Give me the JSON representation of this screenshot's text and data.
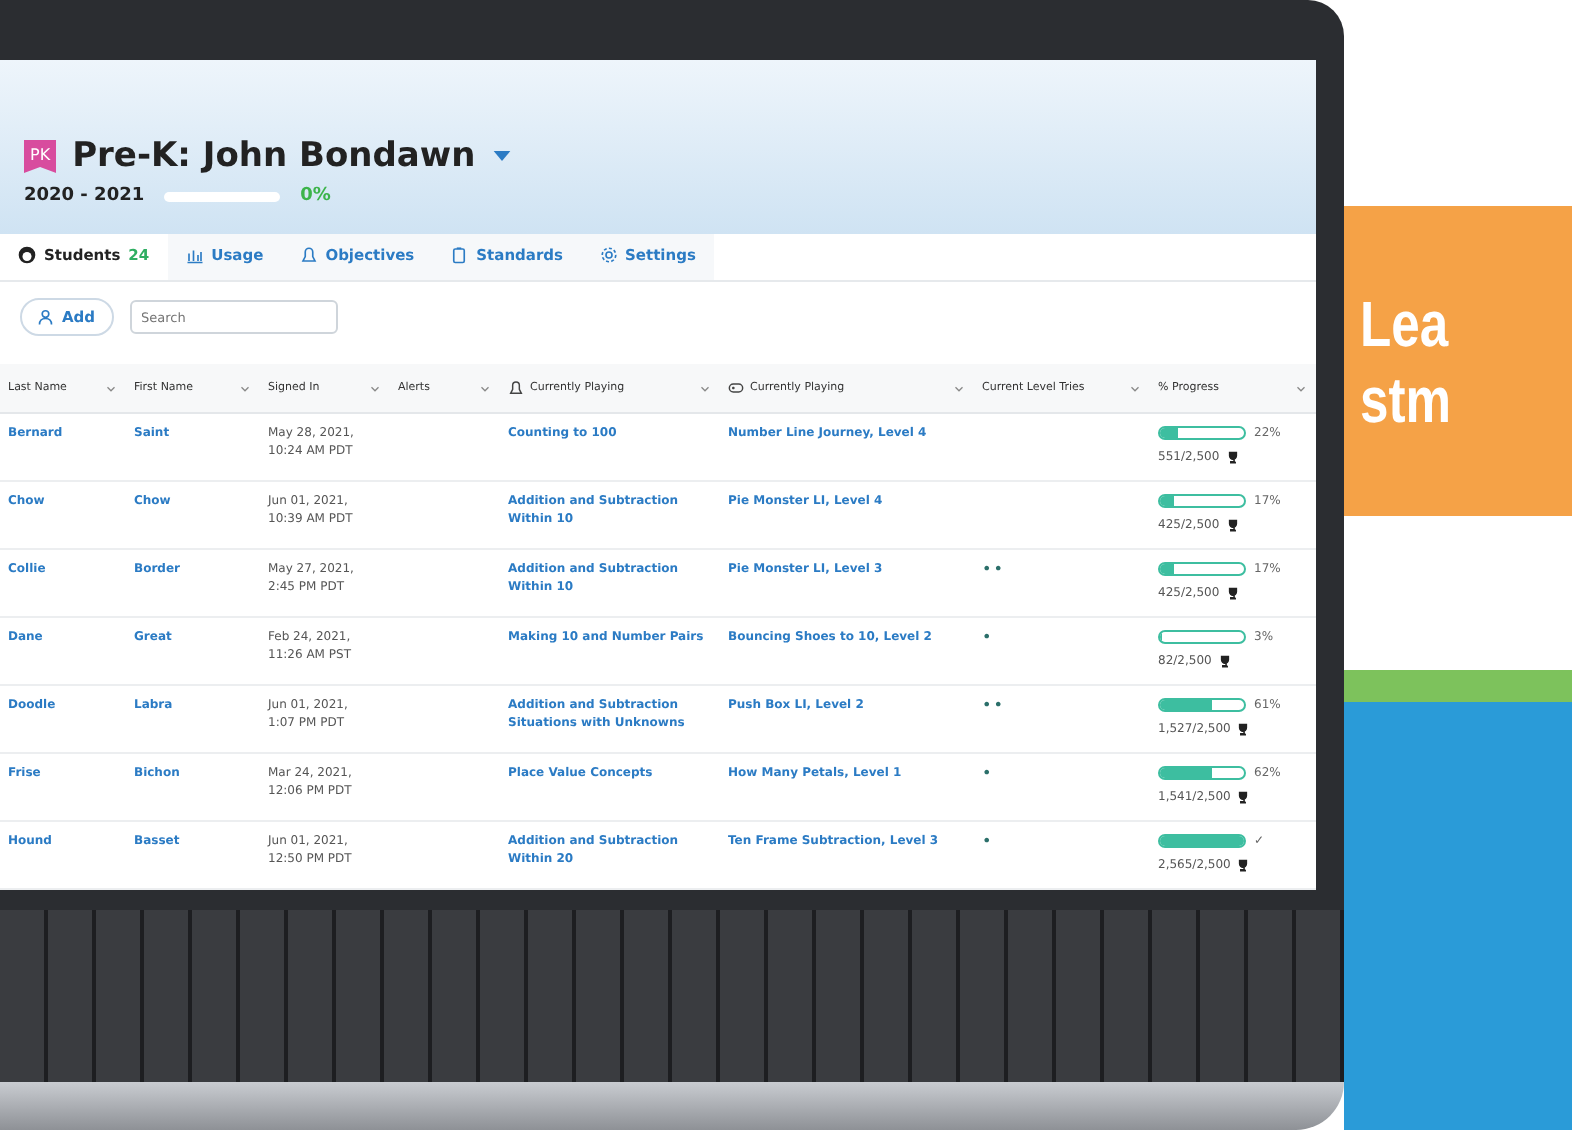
{
  "header": {
    "badge": "PK",
    "title": "Pre-K: John Bondawn",
    "year": "2020 - 2021",
    "progress": {
      "level": 0,
      "reading": "0%"
    }
  },
  "tabs": [
    {
      "label": "Students",
      "count": "24",
      "selected": true
    },
    {
      "label": "Usage",
      "selected": false
    },
    {
      "label": "Objectives",
      "selected": false
    },
    {
      "label": "Standards",
      "selected": false
    },
    {
      "label": "Settings",
      "selected": false
    }
  ],
  "toolbar": {
    "add": "Add",
    "search_placeholder": "Search"
  },
  "table": {
    "columns": [
      "Last Name",
      "First Name",
      "Signed In",
      "Alerts",
      "Currently Playing",
      "Currently Playing",
      "Current Level Tries",
      "% Progress"
    ],
    "rows": [
      {
        "last": "Bernard",
        "first": "Saint",
        "signed": [
          "May 28, 2021,",
          "10:24 AM PDT"
        ],
        "objective": "Counting to 100",
        "game": "Number Line Journey, Level 4",
        "tries": "",
        "level": 0.22,
        "percent": "22%",
        "points": "551/2,500"
      },
      {
        "last": "Chow",
        "first": "Chow",
        "signed": [
          "Jun 01, 2021,",
          "10:39 AM PDT"
        ],
        "objective": "Addition and Subtraction Within 10",
        "game": "Pie Monster LI, Level 4",
        "tries": "",
        "level": 0.17,
        "percent": "17%",
        "points": "425/2,500"
      },
      {
        "last": "Collie",
        "first": "Border",
        "signed": [
          "May 27, 2021,",
          "2:45 PM PDT"
        ],
        "objective": "Addition and Subtraction Within 10",
        "game": "Pie Monster LI, Level 3",
        "tries": "••",
        "level": 0.17,
        "percent": "17%",
        "points": "425/2,500"
      },
      {
        "last": "Dane",
        "first": "Great",
        "signed": [
          "Feb 24, 2021,",
          "11:26 AM PST"
        ],
        "objective": "Making 10 and Number Pairs",
        "game": "Bouncing Shoes to 10, Level 2",
        "tries": "•",
        "level": 0.03,
        "percent": "3%",
        "points": "82/2,500"
      },
      {
        "last": "Doodle",
        "first": "Labra",
        "signed": [
          "Jun 01, 2021,",
          "1:07 PM PDT"
        ],
        "objective": "Addition and Subtraction Situations with Unknowns",
        "game": "Push Box LI, Level 2",
        "tries": "••",
        "level": 0.61,
        "percent": "61%",
        "points": "1,527/2,500"
      },
      {
        "last": "Frise",
        "first": "Bichon",
        "signed": [
          "Mar 24, 2021,",
          "12:06 PM PDT"
        ],
        "objective": "Place Value Concepts",
        "game": "How Many Petals, Level 1",
        "tries": "•",
        "level": 0.62,
        "percent": "62%",
        "points": "1,541/2,500"
      },
      {
        "last": "Hound",
        "first": "Basset",
        "signed": [
          "Jun 01, 2021,",
          "12:50 PM PDT"
        ],
        "objective": "Addition and Subtraction Within 20",
        "game": "Ten Frame Subtraction, Level 3",
        "tries": "•",
        "level": 1,
        "percent": "✓",
        "points": "2,565/2,500"
      }
    ]
  },
  "banner": {
    "lines": [
      "Lea",
      "stm"
    ]
  }
}
